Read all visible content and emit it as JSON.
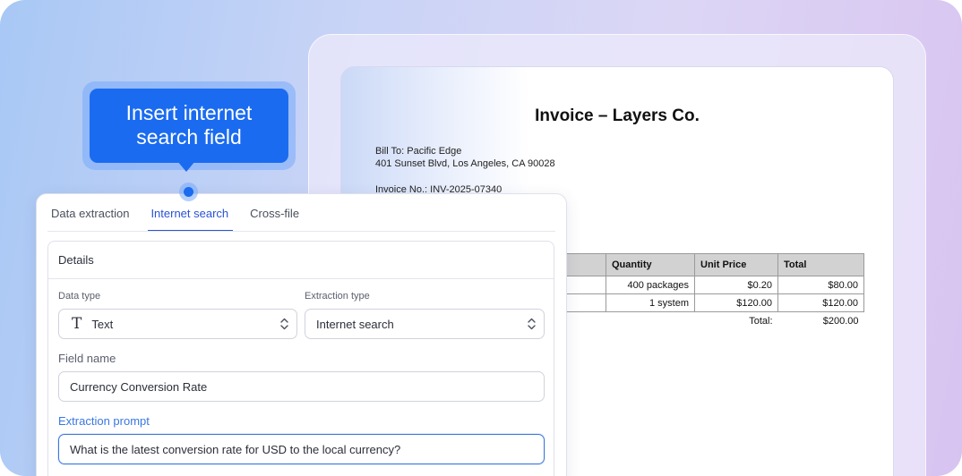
{
  "invoice": {
    "title": "Invoice – Layers Co.",
    "bill_to": "Bill To: Pacific Edge",
    "address": "401 Sunset Blvd, Los Angeles, CA 90028",
    "invoice_no": "Invoice No.: INV-2025-07340",
    "columns": [
      "Quantity",
      "Unit Price",
      "Total"
    ],
    "rows": [
      [
        "400 packages",
        "$0.20",
        "$80.00"
      ],
      [
        "1 system",
        "$120.00",
        "$120.00"
      ]
    ],
    "total_label": "Total:",
    "total_value": "$200.00"
  },
  "tooltip": {
    "line1": "Insert internet",
    "line2": "search field"
  },
  "tabs": [
    "Data extraction",
    "Internet search",
    "Cross-file"
  ],
  "active_tab": "Internet search",
  "details": {
    "heading": "Details",
    "data_type_label": "Data type",
    "data_type_value": "Text",
    "extraction_type_label": "Extraction type",
    "extraction_type_value": "Internet search",
    "field_name_label": "Field name",
    "field_name_value": "Currency Conversion Rate",
    "prompt_label": "Extraction prompt",
    "prompt_value": "What is the latest conversion rate for USD to the local currency?"
  },
  "colors": {
    "accent": "#1a6bf0",
    "tab_active": "#2a52d6"
  },
  "icons": {
    "data_type": "text-type-icon",
    "select": "chevron-up-down-icon"
  }
}
